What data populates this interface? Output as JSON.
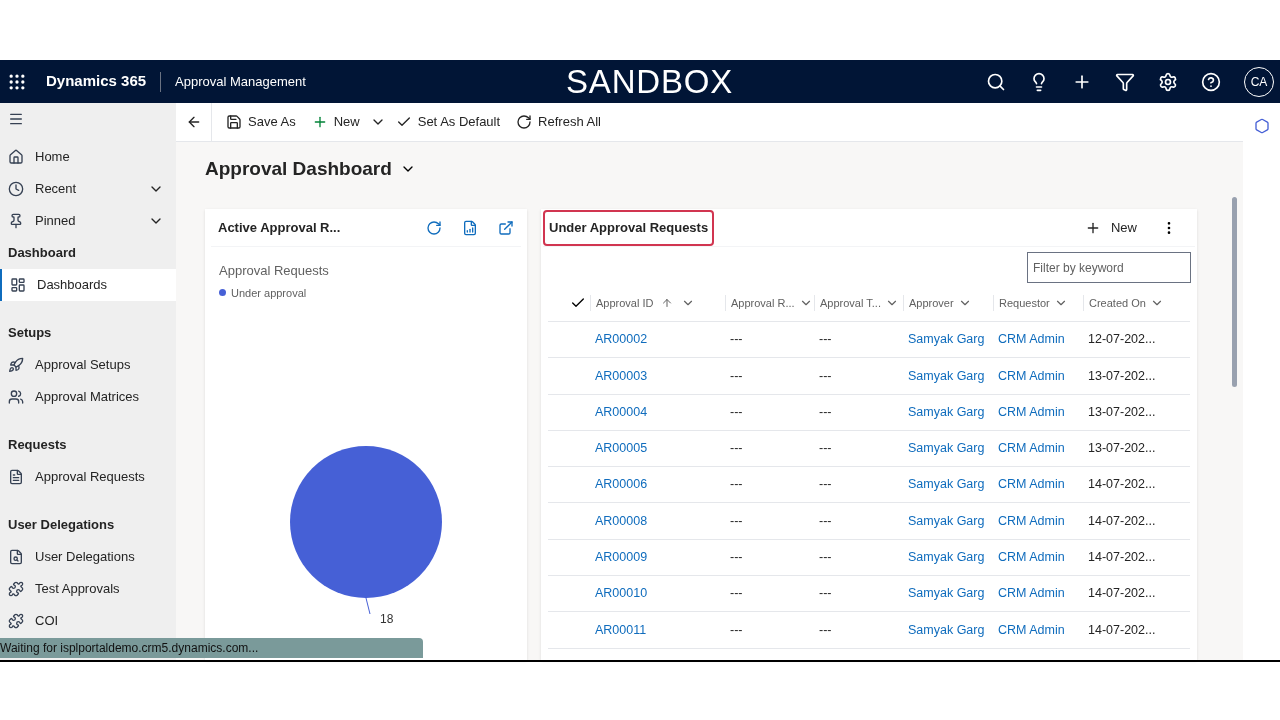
{
  "header": {
    "app_name": "Dynamics 365",
    "area": "Approval Management",
    "environment": "SANDBOX",
    "avatar": "CA"
  },
  "sidebar": {
    "items": [
      {
        "kind": "link",
        "label": "Home",
        "expandable": false,
        "selected": false
      },
      {
        "kind": "link",
        "label": "Recent",
        "expandable": true,
        "selected": false
      },
      {
        "kind": "link",
        "label": "Pinned",
        "expandable": true,
        "selected": false
      },
      {
        "kind": "heading",
        "label": "Dashboard"
      },
      {
        "kind": "link",
        "label": "Dashboards",
        "expandable": false,
        "selected": true
      },
      {
        "kind": "heading",
        "label": "Setups"
      },
      {
        "kind": "link",
        "label": "Approval Setups",
        "expandable": false,
        "selected": false
      },
      {
        "kind": "link",
        "label": "Approval Matrices",
        "expandable": false,
        "selected": false
      },
      {
        "kind": "heading",
        "label": "Requests"
      },
      {
        "kind": "link",
        "label": "Approval Requests",
        "expandable": false,
        "selected": false
      },
      {
        "kind": "heading",
        "label": "User Delegations"
      },
      {
        "kind": "link",
        "label": "User Delegations",
        "expandable": false,
        "selected": false
      },
      {
        "kind": "link",
        "label": "Test Approvals",
        "expandable": false,
        "selected": false
      },
      {
        "kind": "link",
        "label": "COI",
        "expandable": false,
        "selected": false
      }
    ]
  },
  "toolbar": [
    "Save As",
    "New",
    "Set As Default",
    "Refresh All"
  ],
  "dashboard": {
    "title": "Approval Dashboard"
  },
  "chart_panel": {
    "title": "Active Approval R...",
    "chart_data": {
      "type": "pie",
      "categories": [
        "Under approval"
      ],
      "series": [
        {
          "name": "Approval Requests",
          "color": "#4660d6",
          "values": [
            18
          ]
        }
      ],
      "data_labels": true
    }
  },
  "grid_panel": {
    "title": "Under Approval Requests",
    "highlighted": true,
    "new_label": "New",
    "filter_placeholder": "Filter by keyword",
    "columns": [
      {
        "label": "Approval ID",
        "sorted": true
      },
      {
        "label": "Approval R...",
        "sorted": false
      },
      {
        "label": "Approval T...",
        "sorted": false
      },
      {
        "label": "Approver",
        "sorted": false
      },
      {
        "label": "Requestor",
        "sorted": false
      },
      {
        "label": "Created On",
        "sorted": false
      }
    ],
    "rows": [
      [
        "AR00002",
        "---",
        "---",
        "Samyak Garg",
        "CRM Admin",
        "12-07-202..."
      ],
      [
        "AR00003",
        "---",
        "---",
        "Samyak Garg",
        "CRM Admin",
        "13-07-202..."
      ],
      [
        "AR00004",
        "---",
        "---",
        "Samyak Garg",
        "CRM Admin",
        "13-07-202..."
      ],
      [
        "AR00005",
        "---",
        "---",
        "Samyak Garg",
        "CRM Admin",
        "13-07-202..."
      ],
      [
        "AR00006",
        "---",
        "---",
        "Samyak Garg",
        "CRM Admin",
        "14-07-202..."
      ],
      [
        "AR00008",
        "---",
        "---",
        "Samyak Garg",
        "CRM Admin",
        "14-07-202..."
      ],
      [
        "AR00009",
        "---",
        "---",
        "Samyak Garg",
        "CRM Admin",
        "14-07-202..."
      ],
      [
        "AR00010",
        "---",
        "---",
        "Samyak Garg",
        "CRM Admin",
        "14-07-202..."
      ],
      [
        "AR00011",
        "---",
        "---",
        "Samyak Garg",
        "CRM Admin",
        "14-07-202..."
      ]
    ]
  },
  "status_bar": "Waiting for isplportaldemo.crm5.dynamics.com..."
}
